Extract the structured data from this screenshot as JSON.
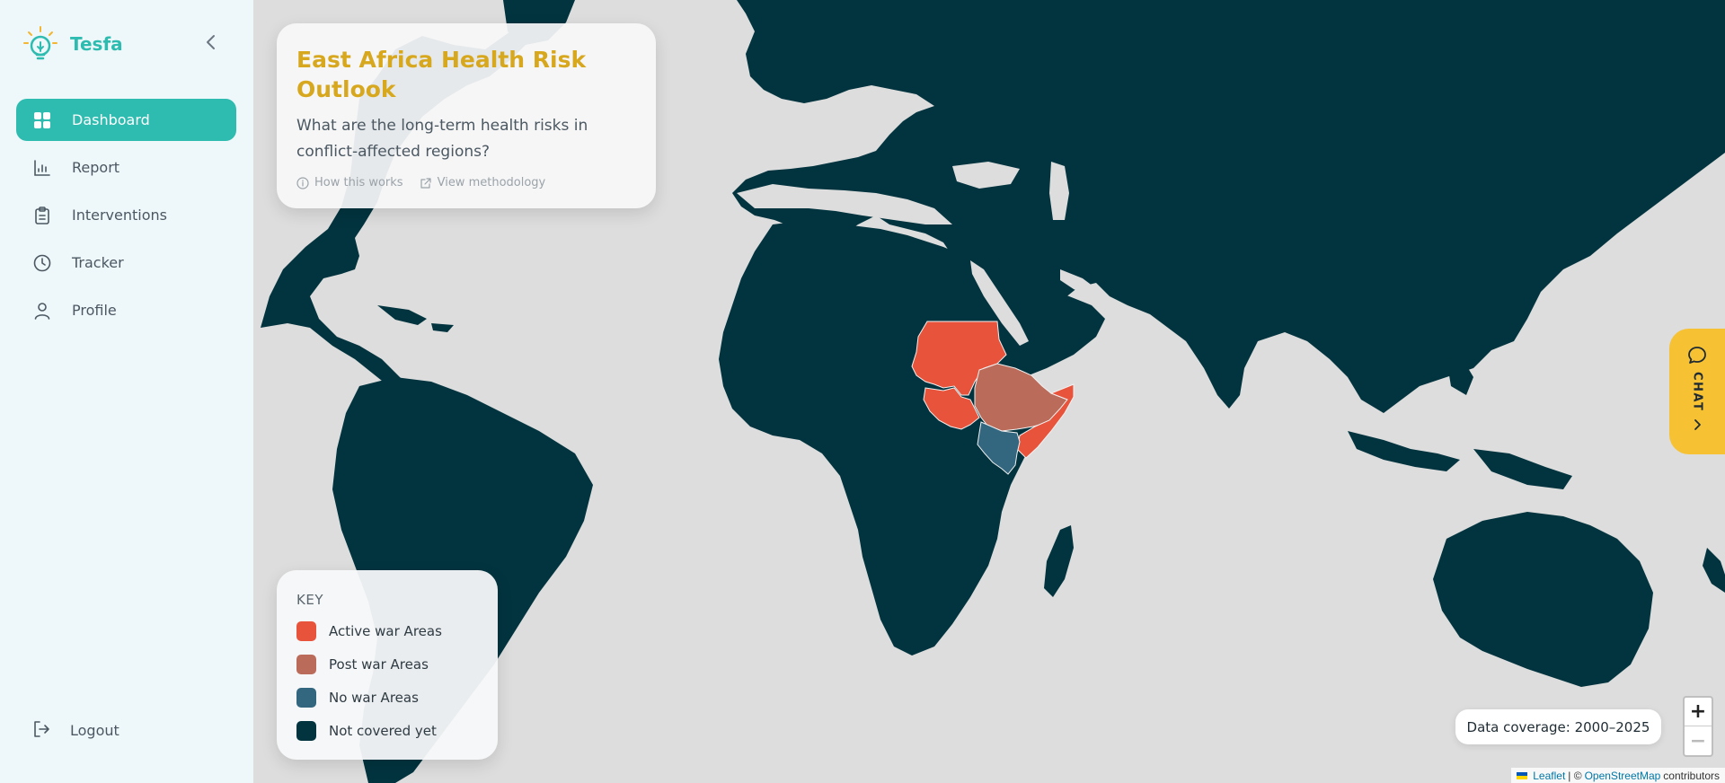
{
  "brand": {
    "name": "Tesfa",
    "logo_icon": "lightbulb-icon",
    "accent": "#2ebcb0"
  },
  "sidebar": {
    "items": [
      {
        "label": "Dashboard",
        "icon": "grid-icon",
        "active": true
      },
      {
        "label": "Report",
        "icon": "bar-chart-icon",
        "active": false
      },
      {
        "label": "Interventions",
        "icon": "clipboard-icon",
        "active": false
      },
      {
        "label": "Tracker",
        "icon": "clock-icon",
        "active": false
      },
      {
        "label": "Profile",
        "icon": "user-icon",
        "active": false
      }
    ],
    "logout_label": "Logout"
  },
  "title_card": {
    "title": "East Africa Health Risk Outlook",
    "question": "What are the long-term health risks in conflict-affected regions?",
    "how_link": "How this works",
    "method_link": "View methodology"
  },
  "key": {
    "title": "KEY",
    "items": [
      {
        "label": "Active war Areas",
        "color": "#e8533b"
      },
      {
        "label": "Post war Areas",
        "color": "#bb6b5a"
      },
      {
        "label": "No war Areas",
        "color": "#33677f"
      },
      {
        "label": "Not covered yet",
        "color": "#02343f"
      }
    ]
  },
  "coverage": "Data coverage: 2000–2025",
  "zoom": {
    "in": "+",
    "out": "−"
  },
  "attribution": {
    "leaflet": "Leaflet",
    "sep": "| ©",
    "osm": "OpenStreetMap",
    "suffix": "contributors"
  },
  "chat": {
    "label": "CHAT",
    "icon": "chat-bubble-icon"
  },
  "map": {
    "land_color": "#02343f",
    "water_color": "#dddddd",
    "regions": [
      {
        "name": "Sudan",
        "status": "Active war Areas"
      },
      {
        "name": "South Sudan",
        "status": "Active war Areas"
      },
      {
        "name": "Somalia",
        "status": "Active war Areas"
      },
      {
        "name": "Ethiopia",
        "status": "Post war Areas"
      },
      {
        "name": "Kenya",
        "status": "No war Areas"
      }
    ]
  }
}
